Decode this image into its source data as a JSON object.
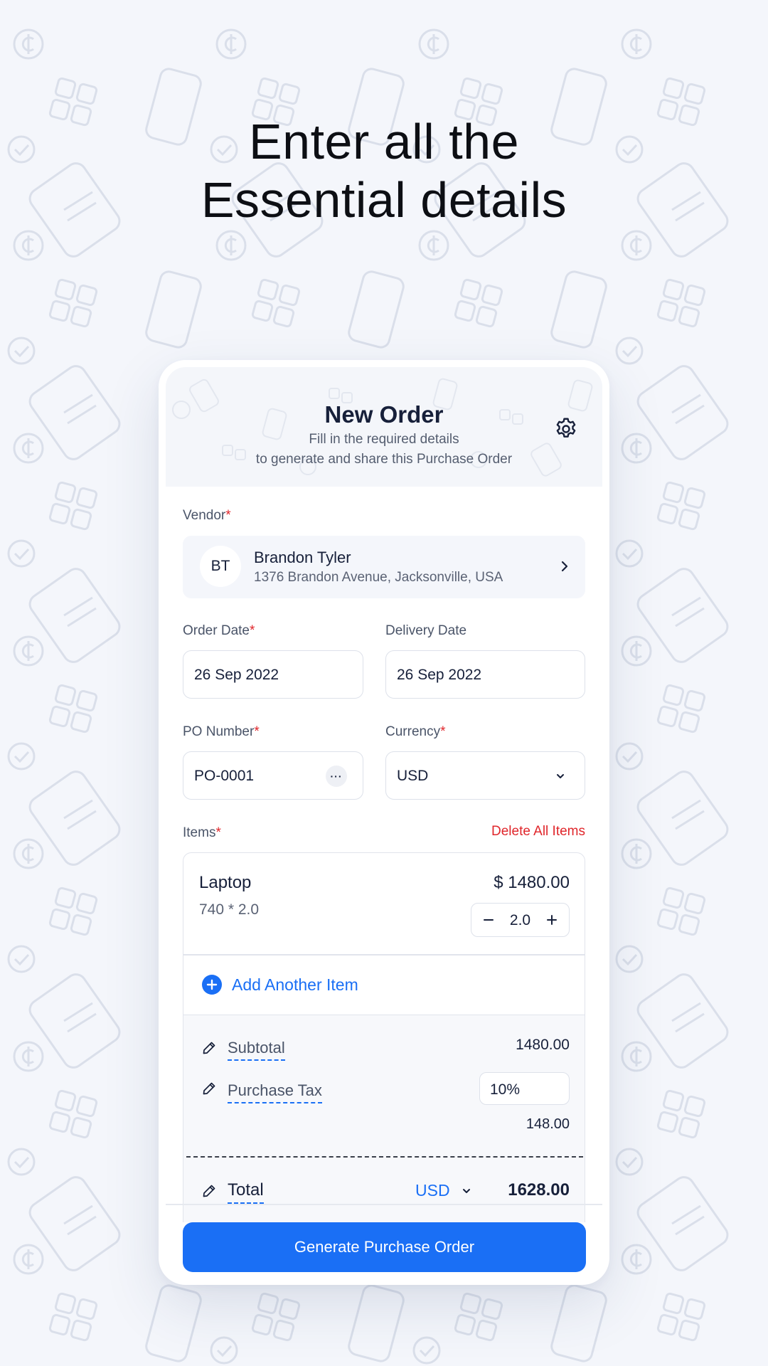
{
  "headline": {
    "line1": "Enter all the",
    "line2": "Essential details"
  },
  "screen": {
    "title": "New Order",
    "subtitle_line1": "Fill in the required details",
    "subtitle_line2": "to generate and share this Purchase Order"
  },
  "vendor": {
    "label": "Vendor",
    "initials": "BT",
    "name": "Brandon Tyler",
    "address": "1376 Brandon Avenue, Jacksonville, USA"
  },
  "order_date": {
    "label": "Order Date",
    "value": "26 Sep 2022"
  },
  "delivery_date": {
    "label": "Delivery Date",
    "value": "26 Sep 2022"
  },
  "po_number": {
    "label": "PO Number",
    "value": "PO-0001",
    "more": "···"
  },
  "currency": {
    "label": "Currency",
    "value": "USD"
  },
  "items": {
    "label": "Items",
    "delete_all": "Delete All Items",
    "list": [
      {
        "name": "Laptop",
        "price": "$ 1480.00",
        "calc": "740 * 2.0",
        "qty": "2.0"
      }
    ],
    "add_another": "Add Another Item"
  },
  "summary": {
    "subtotal_label": "Subtotal",
    "subtotal_value": "1480.00",
    "tax_label": "Purchase Tax",
    "tax_rate": "10%",
    "tax_value": "148.00",
    "total_label": "Total",
    "total_currency": "USD",
    "total_value": "1628.00"
  },
  "cta": "Generate Purchase Order",
  "required_mark": "*",
  "colors": {
    "accent": "#1a6ff5",
    "danger": "#e0262b",
    "background": "#f4f6fb"
  }
}
